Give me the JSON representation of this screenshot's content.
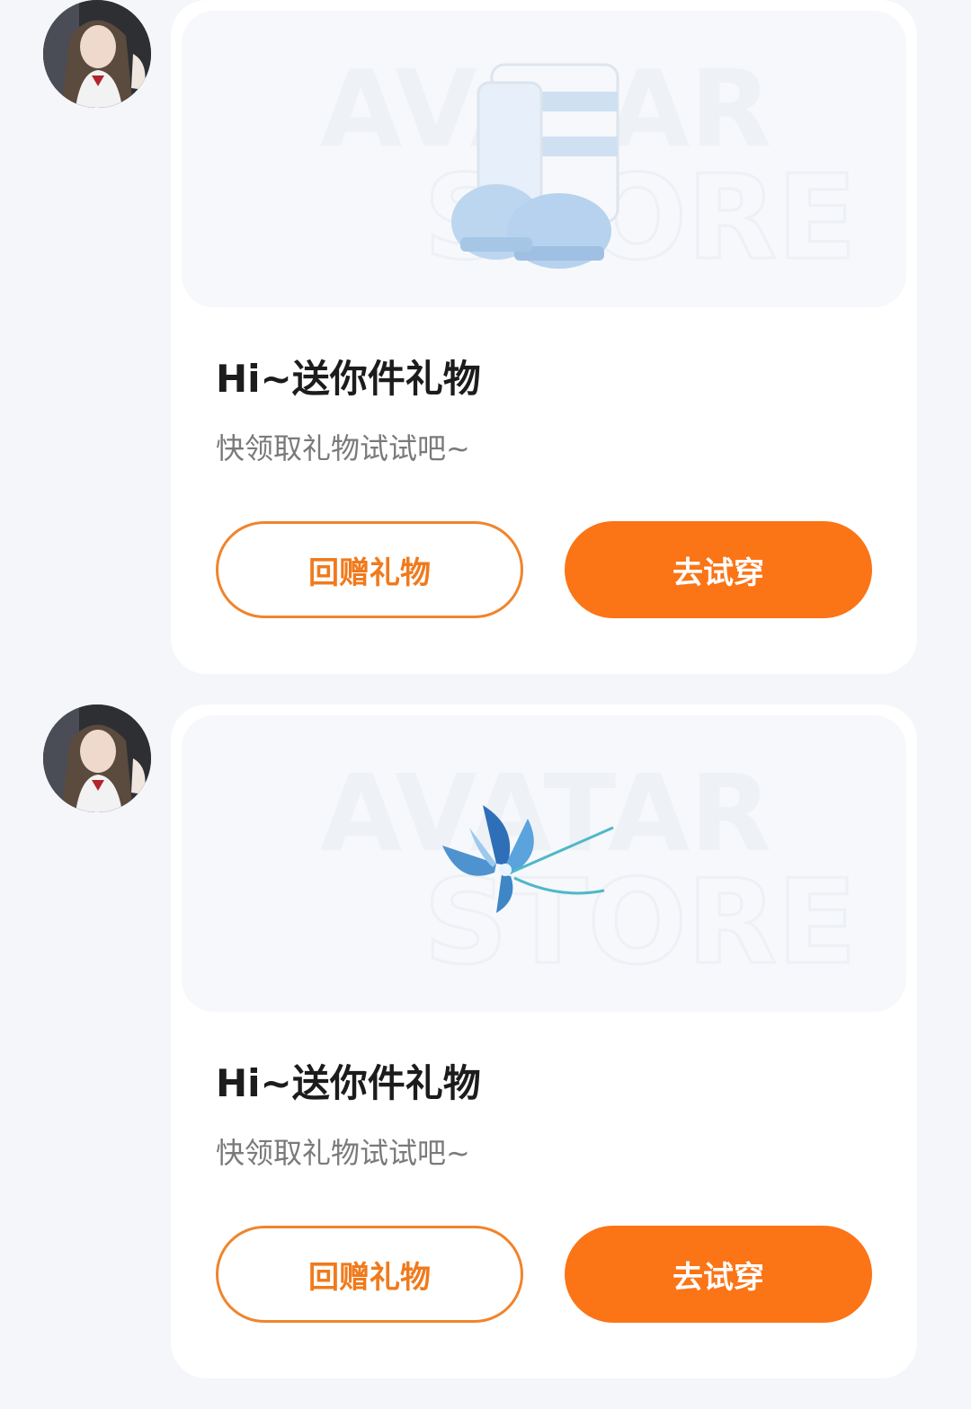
{
  "colors": {
    "page_bg": "#f4f6fa",
    "accent": "#fb7416",
    "outline": "#f0842c"
  },
  "messages": [
    {
      "avatar_icon": "user-avatar-photo",
      "item": "blue fluffy boots",
      "watermark": [
        "AVATAR",
        "STORE"
      ],
      "title": "Hi~送你件礼物",
      "subtitle": "快领取礼物试试吧~",
      "return_gift_label": "回赠礼物",
      "try_on_label": "去试穿"
    },
    {
      "avatar_icon": "user-avatar-photo",
      "item": "blue butterfly hairpin",
      "watermark": [
        "AVATAR",
        "STORE"
      ],
      "title": "Hi~送你件礼物",
      "subtitle": "快领取礼物试试吧~",
      "return_gift_label": "回赠礼物",
      "try_on_label": "去试穿"
    }
  ]
}
